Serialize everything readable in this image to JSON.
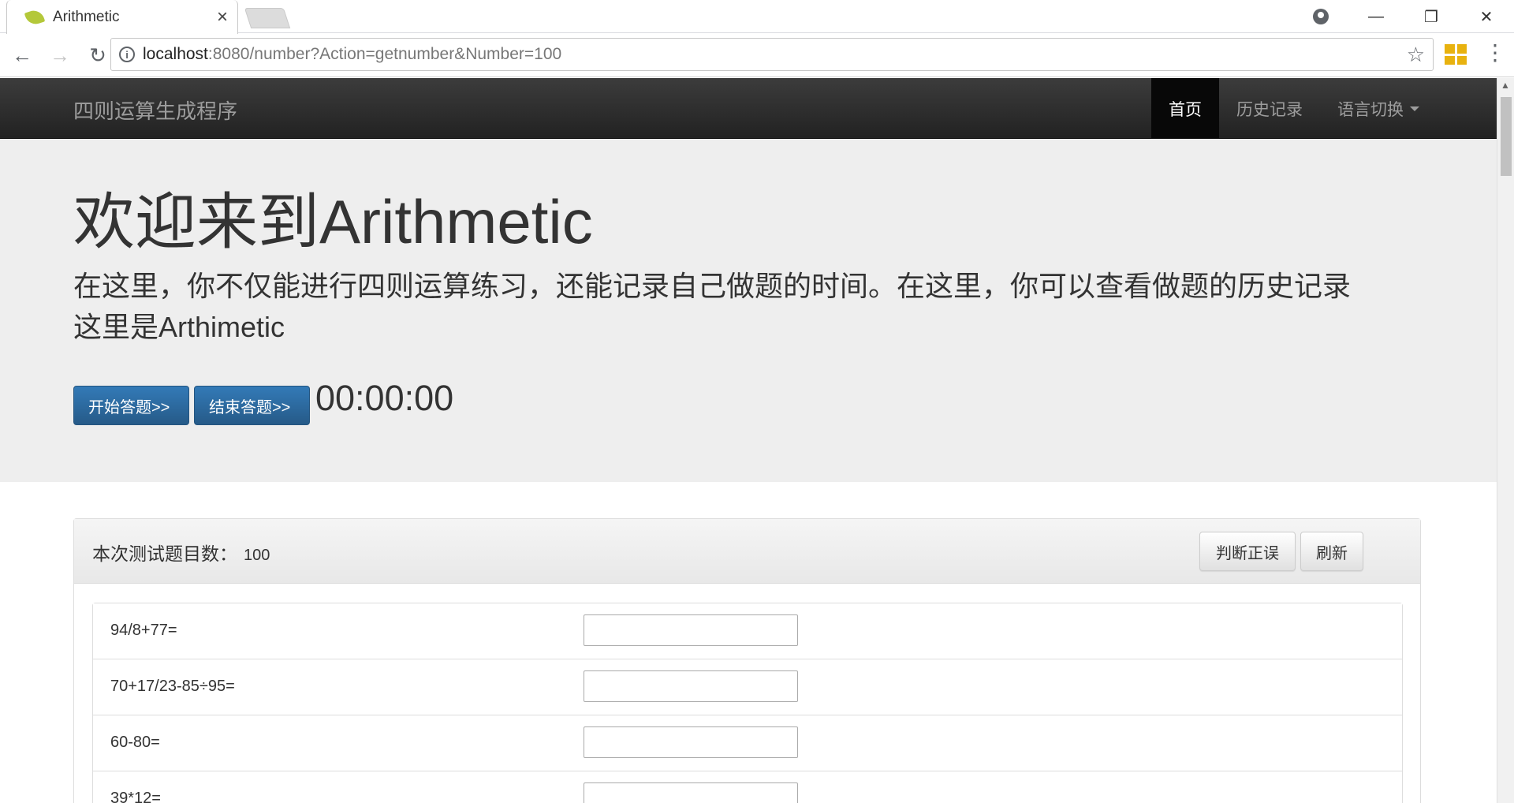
{
  "browser": {
    "tab_title": "Arithmetic",
    "tab_close": "×",
    "url_host": "localhost",
    "url_rest": ":8080/number?Action=getnumber&Number=100",
    "window": {
      "minimize": "—",
      "restore": "❐",
      "close": "✕"
    }
  },
  "navbar": {
    "brand": "四则运算生成程序",
    "links": [
      {
        "label": "首页",
        "active": true
      },
      {
        "label": "历史记录",
        "active": false
      },
      {
        "label": "语言切换",
        "active": false
      }
    ]
  },
  "jumbotron": {
    "title": "欢迎来到Arithmetic",
    "text_line1": "在这里，你不仅能进行四则运算练习，还能记录自己做题的时间。在这里，你可以查看做题的历史记录",
    "text_line2": "这里是Arthimetic",
    "start_button": "开始答题>>",
    "end_button": "结束答题>>",
    "timer": "00:00:00"
  },
  "panel": {
    "count_label": "本次测试题目数：",
    "count_value": "100",
    "judge_button": "判断正误",
    "refresh_button": "刷新",
    "questions": [
      {
        "expr": "94/8+77=",
        "answer": ""
      },
      {
        "expr": "70+17/23-85÷95=",
        "answer": ""
      },
      {
        "expr": "60-80=",
        "answer": ""
      },
      {
        "expr": "39*12=",
        "answer": ""
      }
    ]
  }
}
